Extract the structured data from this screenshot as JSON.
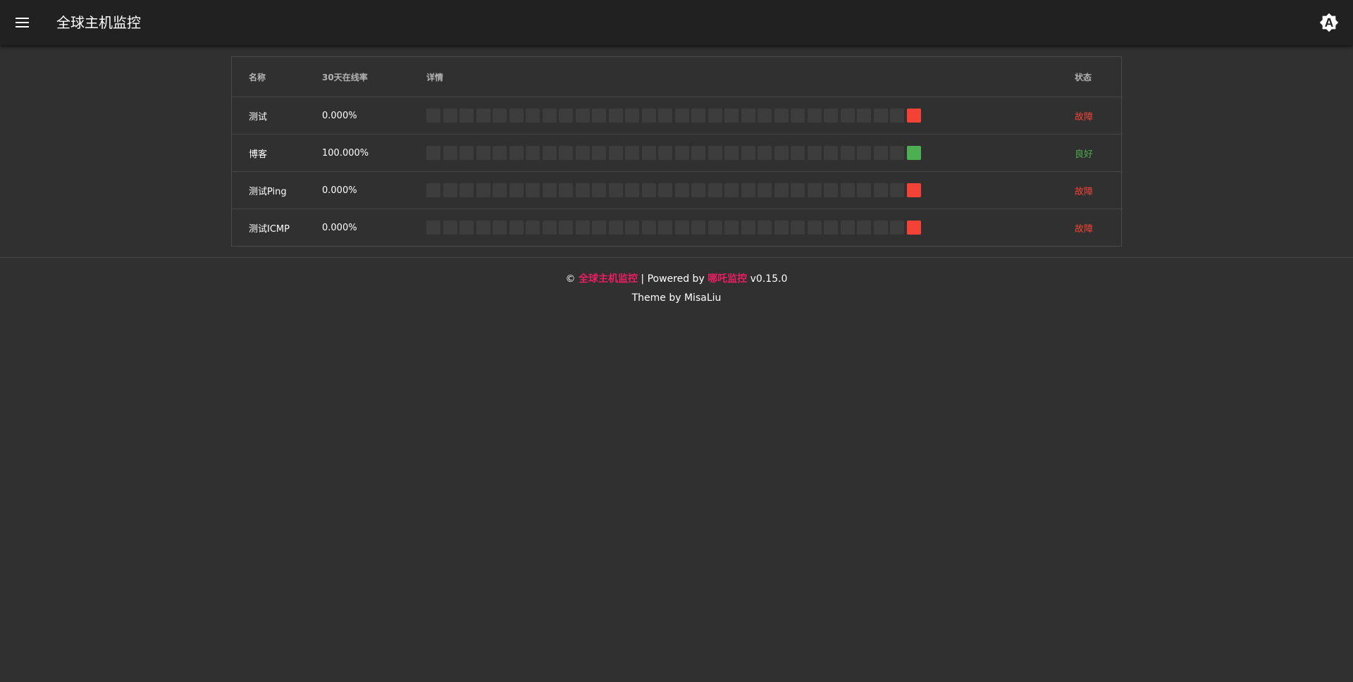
{
  "header": {
    "menu_icon": "menu-icon",
    "title": "全球主机监控",
    "theme_icon": "brightness-auto-icon"
  },
  "table": {
    "columns": [
      "名称",
      "30天在线率",
      "详情",
      "状态"
    ],
    "rows": [
      {
        "name": "测试",
        "uptime": "0.000%",
        "status": "故障",
        "status_color": "#f44336",
        "bar_count": 30,
        "last_day_color": "#f44336"
      },
      {
        "name": "博客",
        "uptime": "100.000%",
        "status": "良好",
        "status_color": "#4caf50",
        "bar_count": 30,
        "last_day_color": "#4caf50"
      },
      {
        "name": "测试Ping",
        "uptime": "0.000%",
        "status": "故障",
        "status_color": "#f44336",
        "bar_count": 30,
        "last_day_color": "#f44336"
      },
      {
        "name": "测试ICMP",
        "uptime": "0.000%",
        "status": "故障",
        "status_color": "#f44336",
        "bar_count": 30,
        "last_day_color": "#f44336"
      }
    ],
    "empty_bar_color": "#3d3d3d"
  },
  "footer": {
    "copyright": "©",
    "site_link": "全球主机监控",
    "powered_by": "| Powered by",
    "nezha_link": "哪吒监控",
    "version": "v0.15.0",
    "theme_credit": "Theme by MisaLiu",
    "accent_color": "#e91e63"
  }
}
